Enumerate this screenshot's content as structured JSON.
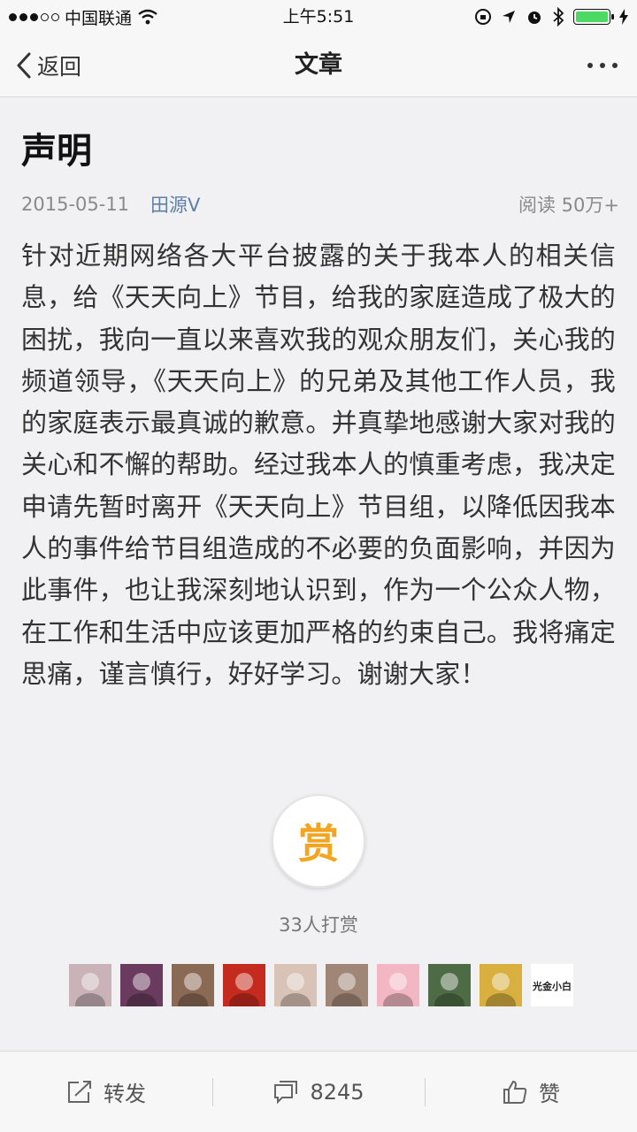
{
  "status_bar": {
    "carrier": "中国联通",
    "time": "上午5:51",
    "battery_level": 1.0,
    "colors": {
      "battery": "#4cd964"
    }
  },
  "nav": {
    "back_label": "返回",
    "title": "文章"
  },
  "article": {
    "title": "声明",
    "date": "2015-05-11",
    "author": "田源V",
    "reads_label": "阅读",
    "reads_value": "50万+",
    "body": "针对近期网络各大平台披露的关于我本人的相关信息，给《天天向上》节目，给我的家庭造成了极大的困扰，我向一直以来喜欢我的观众朋友们，关心我的频道领导，《天天向上》的兄弟及其他工作人员，我的家庭表示最真诚的歉意。并真挚地感谢大家对我的关心和不懈的帮助。经过我本人的慎重考虑，我决定申请先暂时离开《天天向上》节目组，以降低因我本人的事件给节目组造成的不必要的负面影响，并因为此事件，也让我深刻地认识到，作为一个公众人物，在工作和生活中应该更加严格的约束自己。我将痛定思痛，谨言慎行，好好学习。谢谢大家！"
  },
  "reward": {
    "button_label": "赏",
    "count_label": "33人打赏",
    "avatar_count": 10,
    "avatars": [
      {
        "icon": "avatar-photo",
        "color": "#c9b2b8"
      },
      {
        "icon": "avatar-anime",
        "color": "#6a3b5e"
      },
      {
        "icon": "avatar-photo",
        "color": "#8a6a55"
      },
      {
        "icon": "avatar-photo",
        "color": "#c42a1e"
      },
      {
        "icon": "avatar-photo",
        "color": "#d8c3b6"
      },
      {
        "icon": "avatar-photo",
        "color": "#a08676"
      },
      {
        "icon": "avatar-cartoon",
        "color": "#f2b7c3"
      },
      {
        "icon": "avatar-photo",
        "color": "#4d6b44"
      },
      {
        "icon": "avatar-photo",
        "color": "#d9b040"
      },
      {
        "icon": "avatar-logo",
        "color": "#ffffff",
        "logo_text": "光金小白"
      }
    ]
  },
  "toolbar": {
    "share_label": "转发",
    "comment_count": "8245",
    "like_label": "赞"
  },
  "colors": {
    "accent_link": "#607fa6",
    "reward_gold": "#f3a522"
  }
}
